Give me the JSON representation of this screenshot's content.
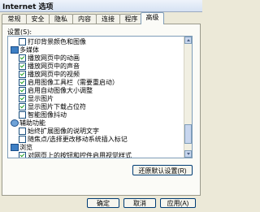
{
  "window": {
    "title": "Internet 选项"
  },
  "tabs": [
    {
      "label": "常规"
    },
    {
      "label": "安全"
    },
    {
      "label": "隐私"
    },
    {
      "label": "内容"
    },
    {
      "label": "连接"
    },
    {
      "label": "程序"
    },
    {
      "label": "高级",
      "active": true
    }
  ],
  "settings_label": "设置(S):",
  "list": [
    {
      "kind": "checkbox",
      "checked": false,
      "indent": 1,
      "label": "打印背景颜色和图像"
    },
    {
      "kind": "folder",
      "icon": "folder-icon",
      "indent": 0,
      "label": "多媒体"
    },
    {
      "kind": "checkbox",
      "checked": true,
      "indent": 1,
      "label": "播放网页中的动画"
    },
    {
      "kind": "checkbox",
      "checked": true,
      "indent": 1,
      "label": "播放网页中的声音"
    },
    {
      "kind": "checkbox",
      "checked": true,
      "indent": 1,
      "label": "播放网页中的视频"
    },
    {
      "kind": "checkbox",
      "checked": true,
      "indent": 1,
      "label": "启用图像工具栏（需要重启动）"
    },
    {
      "kind": "checkbox",
      "checked": true,
      "indent": 1,
      "label": "启用自动图像大小调整"
    },
    {
      "kind": "checkbox",
      "checked": true,
      "indent": 1,
      "label": "显示图片"
    },
    {
      "kind": "checkbox",
      "checked": true,
      "indent": 1,
      "label": "显示图片下载占位符"
    },
    {
      "kind": "checkbox",
      "checked": false,
      "indent": 1,
      "label": "智能图像抖动"
    },
    {
      "kind": "folder",
      "icon": "accessibility-icon",
      "indent": 0,
      "label": "辅助功能"
    },
    {
      "kind": "checkbox",
      "checked": false,
      "indent": 1,
      "label": "始终扩展图像的说明文字"
    },
    {
      "kind": "checkbox",
      "checked": false,
      "indent": 1,
      "label": "随焦点/选择更改移动系统插入标记"
    },
    {
      "kind": "folder",
      "icon": "folder-icon",
      "indent": 0,
      "label": "浏览"
    },
    {
      "kind": "checkbox",
      "checked": true,
      "indent": 1,
      "label": "对网页上的按钮和控件启用视觉样式"
    }
  ],
  "reset_button": "还原默认设置(R)",
  "footer": {
    "ok": "确定",
    "cancel": "取消",
    "apply": "应用(A)"
  }
}
